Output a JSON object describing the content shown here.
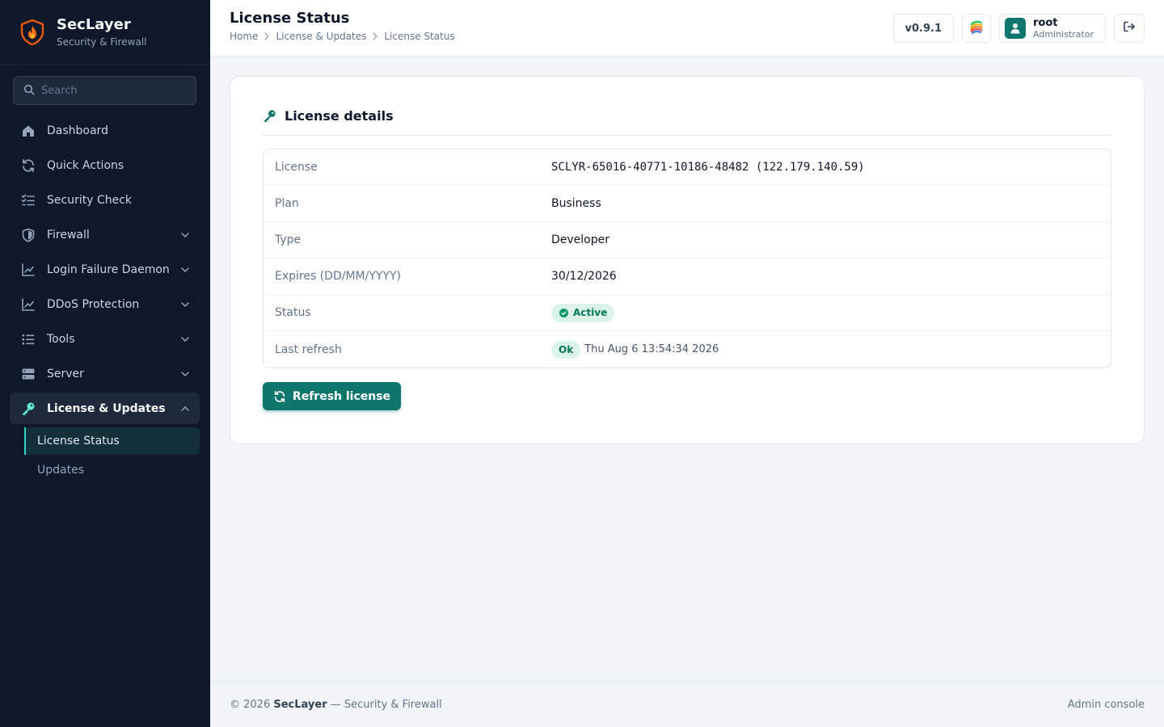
{
  "brand": {
    "title": "SecLayer",
    "subtitle": "Security & Firewall",
    "logo_icon": "flame-shield-icon"
  },
  "search": {
    "placeholder": "Search"
  },
  "sidebar": {
    "items": [
      {
        "label": "Dashboard",
        "icon": "home-icon",
        "expandable": false
      },
      {
        "label": "Quick Actions",
        "icon": "refresh-icon",
        "expandable": false
      },
      {
        "label": "Security Check",
        "icon": "checklist-icon",
        "expandable": false
      },
      {
        "label": "Firewall",
        "icon": "shield-icon",
        "expandable": true
      },
      {
        "label": "Login Failure Daemon",
        "icon": "chart-line-icon",
        "expandable": true
      },
      {
        "label": "DDoS Protection",
        "icon": "chart-line-icon",
        "expandable": true
      },
      {
        "label": "Tools",
        "icon": "list-icon",
        "expandable": true
      },
      {
        "label": "Server",
        "icon": "server-icon",
        "expandable": true
      },
      {
        "label": "License & Updates",
        "icon": "key-icon",
        "expandable": true,
        "expanded": true,
        "active": true
      }
    ],
    "subitems": [
      {
        "label": "License Status",
        "current": true
      },
      {
        "label": "Updates",
        "current": false
      }
    ]
  },
  "header": {
    "title": "License Status",
    "breadcrumb": [
      "Home",
      "License & Updates",
      "License Status"
    ],
    "version": "v0.9.1",
    "user": {
      "name": "root",
      "role": "Administrator"
    }
  },
  "card": {
    "title": "License details",
    "rows": {
      "license": {
        "label": "License",
        "value": "SCLYR-65016-40771-10186-48482 (122.179.140.59)"
      },
      "plan": {
        "label": "Plan",
        "value": "Business"
      },
      "type": {
        "label": "Type",
        "value": "Developer"
      },
      "expires": {
        "label": "Expires (DD/MM/YYYY)",
        "value": "30/12/2026"
      },
      "status": {
        "label": "Status",
        "value": "Active"
      },
      "last_refresh": {
        "label": "Last refresh",
        "badge": "Ok",
        "value": "Thu Aug 6 13:54:34 2026"
      }
    },
    "refresh_button": "Refresh license"
  },
  "footer": {
    "copyright": "© 2026",
    "brand": "SecLayer",
    "tagline": "— Security & Firewall",
    "right": "Admin console"
  },
  "colors": {
    "sidebar_bg": "#0f172a",
    "accent": "#0f766e",
    "success": "#047857",
    "page_bg": "#f1f5f9"
  }
}
